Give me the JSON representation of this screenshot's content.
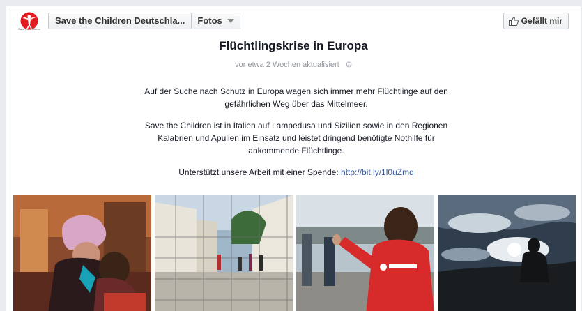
{
  "header": {
    "logo_text": "Save the Children",
    "page_name": "Save the Children Deutschla...",
    "section": "Fotos",
    "like_label": "Gefällt mir"
  },
  "album": {
    "title": "Flüchtlingskrise in Europa",
    "updated": "vor etwa 2 Wochen aktualisiert",
    "paragraph1": "Auf der Suche nach Schutz in Europa wagen sich immer mehr Flüchtlinge auf den gefährlichen Weg über das Mittelmeer.",
    "paragraph2": "Save the Children ist in Italien auf Lampedusa und Sizilien sowie in den Regionen Kalabrien und Apulien im Einsatz und leistet dringend benötigte Nothilfe für ankommende Flüchtlinge.",
    "paragraph3_prefix": "Unterstützt unsere Arbeit mit einer Spende: ",
    "donation_link": "http://bit.ly/1l0uZmq"
  },
  "photos": [
    {
      "name": "photo-mother-child"
    },
    {
      "name": "photo-camp-courtyard"
    },
    {
      "name": "photo-aid-worker"
    },
    {
      "name": "photo-silhouette-sky"
    }
  ],
  "colors": {
    "link": "#3b5998",
    "brand_red": "#e31b23"
  },
  "icons": [
    "save-the-children-logo",
    "chevron-down-icon",
    "thumbs-up-icon",
    "globe-icon"
  ]
}
